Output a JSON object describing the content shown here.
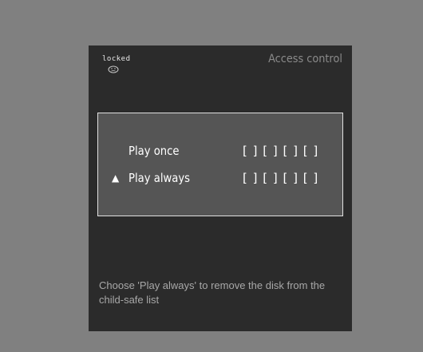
{
  "panel": {
    "status_label": "locked",
    "status_icon": "sad-face-icon",
    "title": "Access control"
  },
  "options": [
    {
      "label": "Play once",
      "code": "[ ] [ ] [ ] [ ]",
      "selected": false
    },
    {
      "label": "Play always",
      "code": "[ ] [ ] [ ] [ ]",
      "selected": true,
      "cursor": "▲"
    }
  ],
  "hint": "Choose 'Play always' to remove the disk from the child-safe list",
  "colors": {
    "background": "#808080",
    "panel": "#2b2b2b",
    "code_box": "#555555",
    "title": "#8a8a8a",
    "hint": "#a8a8a8"
  }
}
